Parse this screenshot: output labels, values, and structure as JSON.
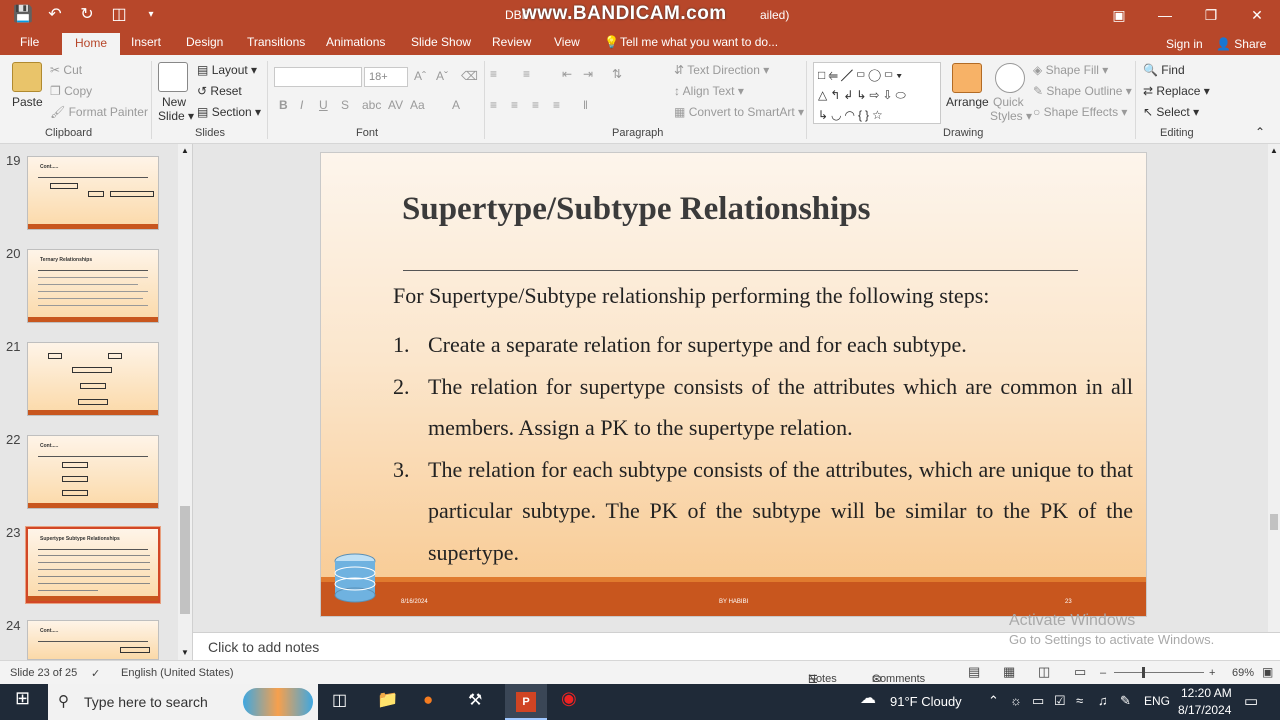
{
  "titlebar": {
    "doc_title_left": "DBF",
    "doc_title_right": "ailed)",
    "watermark": "www.BANDICAM.com",
    "qat_icons": [
      "save-icon",
      "undo-icon",
      "redo-icon",
      "present-icon",
      "customize-icon"
    ],
    "window_controls": [
      "ribbon-display-icon",
      "minimize-icon",
      "restore-icon",
      "close-icon"
    ]
  },
  "tabs": [
    "File",
    "Home",
    "Insert",
    "Design",
    "Transitions",
    "Animations",
    "Slide Show",
    "Review",
    "View"
  ],
  "tell_me": "Tell me what you want to do...",
  "account": {
    "signin": "Sign in",
    "share": "Share"
  },
  "ribbon": {
    "clipboard": {
      "paste": "Paste",
      "cut": "Cut",
      "copy": "Copy",
      "format_painter": "Format Painter",
      "group": "Clipboard"
    },
    "slides": {
      "new_slide": "New",
      "new_slide2": "Slide ▾",
      "layout": "Layout ▾",
      "reset": "Reset",
      "section": "Section ▾",
      "group": "Slides"
    },
    "font": {
      "font_name": "",
      "font_size": "18+",
      "group": "Font"
    },
    "paragraph": {
      "text_direction": "Text Direction ▾",
      "align_text": "Align Text ▾",
      "convert": "Convert to SmartArt ▾",
      "group": "Paragraph"
    },
    "drawing": {
      "arrange": "Arrange",
      "quick_styles": "Quick",
      "quick_styles2": "Styles ▾",
      "shape_fill": "Shape Fill ▾",
      "shape_outline": "Shape Outline ▾",
      "shape_effects": "Shape Effects ▾",
      "group": "Drawing"
    },
    "editing": {
      "find": "Find",
      "replace": "Replace ▾",
      "select": "Select ▾",
      "group": "Editing"
    }
  },
  "thumbnails": [
    {
      "num": "19",
      "title": "Cont.....",
      "selected": false
    },
    {
      "num": "20",
      "title": "Ternary Relationships",
      "selected": false
    },
    {
      "num": "21",
      "title": "",
      "selected": false
    },
    {
      "num": "22",
      "title": "Cont.....",
      "selected": false
    },
    {
      "num": "23",
      "title": "Supertype Subtype Relationships",
      "selected": true
    },
    {
      "num": "24",
      "title": "Cont.....",
      "selected": false
    }
  ],
  "slide": {
    "title": "Supertype/Subtype Relationships",
    "lead": "For Supertype/Subtype relationship performing the following steps:",
    "steps": [
      {
        "num": "1.",
        "text": "Create a separate relation for supertype and for each subtype."
      },
      {
        "num": "2.",
        "text": "The relation for supertype consists of the attributes which are common in all members. Assign a PK to the supertype relation."
      },
      {
        "num": "3.",
        "text": "The relation for each subtype consists of the attributes, which are unique to that particular subtype. The PK of the subtype will be similar to the PK of the supertype."
      }
    ],
    "footer_date": "8/16/2024",
    "footer_author": "BY HABIBI",
    "footer_page": "23"
  },
  "notes_placeholder": "Click to add notes",
  "activate": {
    "line1": "Activate Windows",
    "line2": "Go to Settings to activate Windows."
  },
  "statusbar": {
    "slide_count": "Slide 23 of 25",
    "language": "English (United States)",
    "notes": "Notes",
    "comments": "Comments",
    "zoom": "69%"
  },
  "taskbar": {
    "search_placeholder": "Type here to search",
    "weather": "91°F  Cloudy",
    "lang": "ENG",
    "time": "12:20 AM",
    "date": "8/17/2024"
  }
}
